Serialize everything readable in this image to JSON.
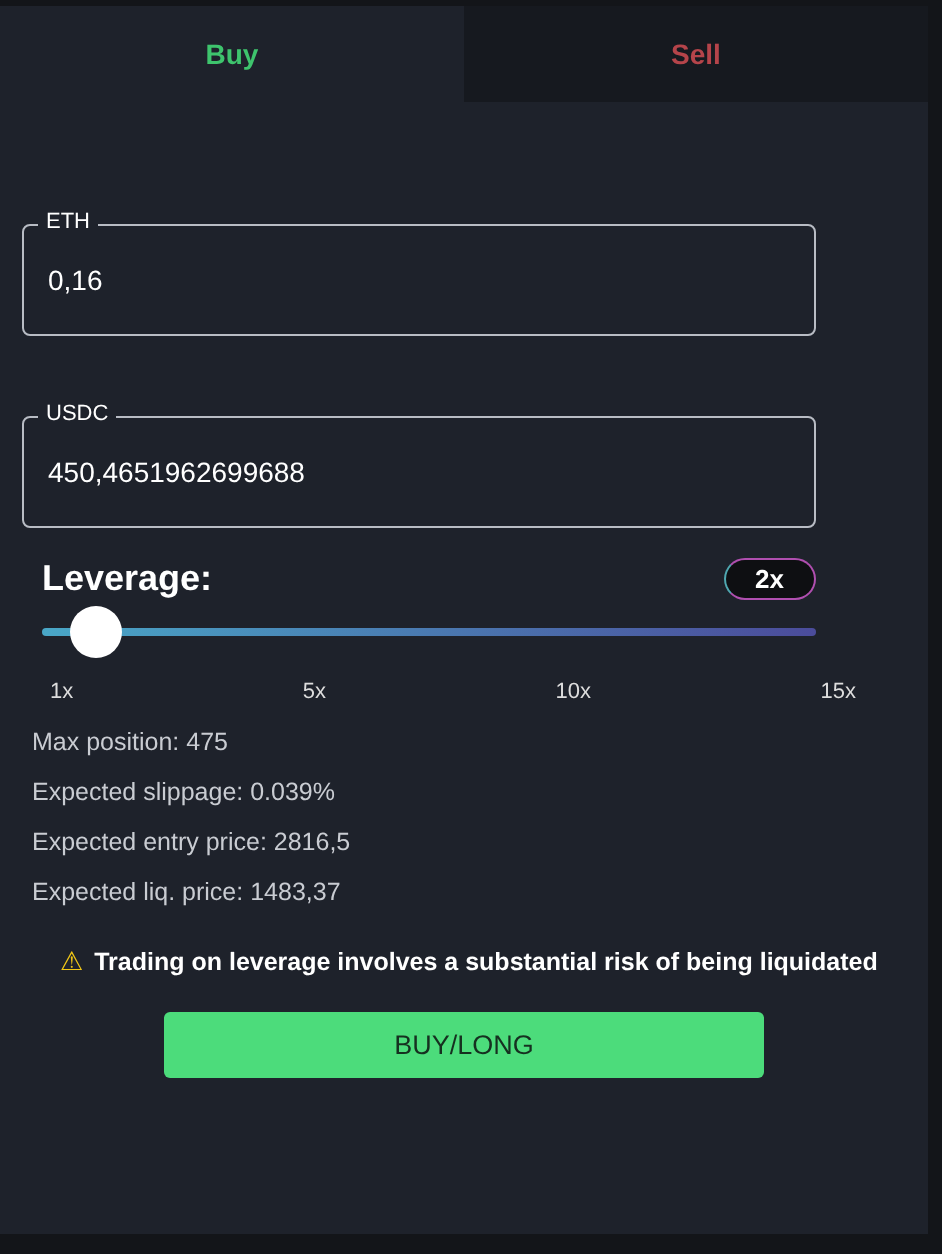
{
  "tabs": [
    {
      "label": "Buy",
      "kind": "buy",
      "selected": true
    },
    {
      "label": "Sell",
      "kind": "sell",
      "selected": false
    }
  ],
  "fields": [
    {
      "label": "ETH",
      "value": "0,16"
    },
    {
      "label": "USDC",
      "value": "450,4651962699688"
    }
  ],
  "leverage": {
    "label": "Leverage:",
    "badge": "2x",
    "level": 0.071,
    "ticks": [
      "1x",
      "5x",
      "10x",
      "15x"
    ]
  },
  "info": [
    "Max position: 475",
    "Expected slippage: 0.039%",
    "Expected entry price: 2816,5",
    "Expected liq. price: 1483,37"
  ],
  "warning": {
    "icon": "⚠",
    "text": "Trading on leverage involves a substantial risk of being liquidated"
  },
  "action_button": "BUY/LONG"
}
